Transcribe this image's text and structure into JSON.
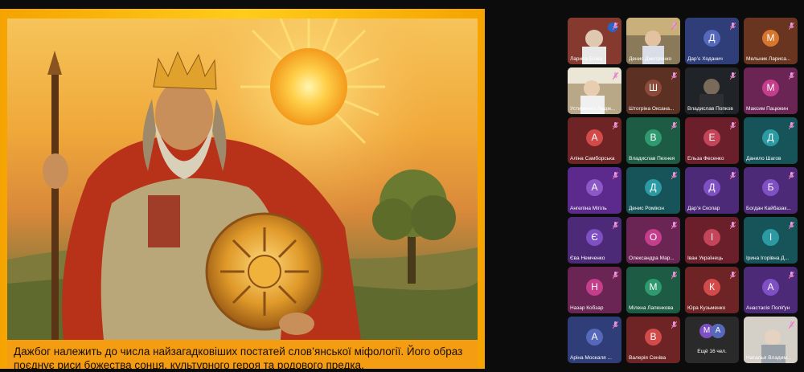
{
  "slide": {
    "caption_line1": "Дажбог належить до числа найзагадковіших постатей слов’янської міфології. Його образ",
    "caption_line2": "поєднує риси божества сонця, культурного героя та родового предка."
  },
  "participants": [
    {
      "name": "Лариса Білка",
      "type": "camera"
    },
    {
      "name": "Денис Дмитренко",
      "type": "camera"
    },
    {
      "name": "Дар’є Ходанич",
      "initial": "Д",
      "type": "avatar",
      "color": "blue"
    },
    {
      "name": "Мельник Лариса...",
      "initial": "М",
      "type": "avatar",
      "color": "orange"
    },
    {
      "name": "Устименко Людм...",
      "type": "camera"
    },
    {
      "name": "Штогріна Оксана...",
      "initial": "Ш",
      "type": "avatar",
      "color": "brown"
    },
    {
      "name": "Владислав Попков",
      "type": "camera"
    },
    {
      "name": "Максим Пацюкин",
      "initial": "М",
      "type": "avatar",
      "color": "magenta"
    },
    {
      "name": "Аліна Самборська",
      "initial": "А",
      "type": "avatar",
      "color": "red"
    },
    {
      "name": "Владислав Пехнея",
      "initial": "В",
      "type": "avatar",
      "color": "green"
    },
    {
      "name": "Ельза Фесенко",
      "initial": "Е",
      "type": "avatar",
      "color": "crimson"
    },
    {
      "name": "Данило Шагов",
      "initial": "Д",
      "type": "avatar",
      "color": "teal"
    },
    {
      "name": "Ангеліна Мігіль",
      "initial": "А",
      "type": "avatar",
      "color": "purple"
    },
    {
      "name": "Денис Ромікон",
      "initial": "Д",
      "type": "avatar",
      "color": "teal"
    },
    {
      "name": "Дар’я Скопар",
      "initial": "Д",
      "type": "avatar",
      "color": "plum"
    },
    {
      "name": "Богдан Кайбазак...",
      "initial": "Б",
      "type": "avatar",
      "color": "plum"
    },
    {
      "name": "Єва Немченко",
      "initial": "Є",
      "type": "avatar",
      "color": "plum"
    },
    {
      "name": "Олександра Мар...",
      "initial": "О",
      "type": "avatar",
      "color": "magenta"
    },
    {
      "name": "Іван Українець",
      "initial": "І",
      "type": "avatar",
      "color": "crimson"
    },
    {
      "name": "Ірина Ігорівна Д...",
      "initial": "І",
      "type": "avatar",
      "color": "teal"
    },
    {
      "name": "Назар Кобзар",
      "initial": "Н",
      "type": "avatar",
      "color": "magenta"
    },
    {
      "name": "Мілена Лапенкова",
      "initial": "М",
      "type": "avatar",
      "color": "green"
    },
    {
      "name": "Юра Кузьменко",
      "initial": "К",
      "type": "avatar",
      "color": "red"
    },
    {
      "name": "Анастасія Поліґун",
      "initial": "А",
      "type": "avatar",
      "color": "plum"
    },
    {
      "name": "Аріна Москаля ...",
      "initial": "А",
      "type": "avatar",
      "color": "blue"
    },
    {
      "name": "Валерія Сеніва",
      "initial": "В",
      "type": "avatar",
      "color": "red"
    },
    {
      "name": "Ещё 16 чел.",
      "initial": "М",
      "initial2": "А",
      "type": "more"
    },
    {
      "name": "Наталья Владим...",
      "type": "camera"
    }
  ],
  "colors": {
    "slide_border": "#ffcc1a",
    "caption_bg": "#f49c12",
    "grid_bg": "#0c0c0c"
  },
  "icons": [
    "mic-muted-icon",
    "sun-icon",
    "shield-icon",
    "crown-icon"
  ]
}
